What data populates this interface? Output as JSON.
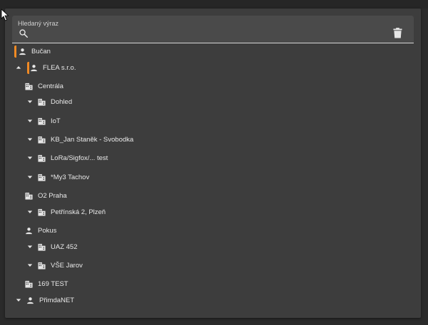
{
  "search": {
    "label": "Hledaný výraz",
    "value": "",
    "placeholder": ""
  },
  "colors": {
    "accent": "#f08a24",
    "panel": "#3d3d3d",
    "background": "#2a2a2a"
  },
  "tree": [
    {
      "id": "n1",
      "label": "Bučan",
      "icon": "person-icon",
      "caret": "none",
      "marked": true
    },
    {
      "id": "n2",
      "label": "FLEA s.r.o.",
      "icon": "person-icon",
      "caret": "up",
      "marked": true
    },
    {
      "id": "n3",
      "label": "Centrála",
      "icon": "building-icon",
      "caret": "none",
      "marked": false
    },
    {
      "id": "n4",
      "label": "Dohled",
      "icon": "building-icon",
      "caret": "down",
      "marked": false
    },
    {
      "id": "n5",
      "label": "IoT",
      "icon": "building-icon",
      "caret": "down",
      "marked": false
    },
    {
      "id": "n6",
      "label": "KB_Jan Staněk - Svobodka",
      "icon": "building-icon",
      "caret": "down",
      "marked": false
    },
    {
      "id": "n7",
      "label": "LoRa/Sigfox/... test",
      "icon": "building-icon",
      "caret": "down",
      "marked": false
    },
    {
      "id": "n8",
      "label": "*My3 Tachov",
      "icon": "building-icon",
      "caret": "down",
      "marked": false
    },
    {
      "id": "n9",
      "label": "O2 Praha",
      "icon": "building-icon",
      "caret": "none",
      "marked": false
    },
    {
      "id": "n10",
      "label": "Petřínská 2, Plzeň",
      "icon": "building-icon",
      "caret": "down",
      "marked": false
    },
    {
      "id": "n11",
      "label": "Pokus",
      "icon": "person-icon",
      "caret": "none",
      "marked": false
    },
    {
      "id": "n12",
      "label": "UAZ 452",
      "icon": "building-icon",
      "caret": "down",
      "marked": false
    },
    {
      "id": "n13",
      "label": "VŠE Jarov",
      "icon": "building-icon",
      "caret": "down",
      "marked": false
    },
    {
      "id": "n14",
      "label": "169 TEST",
      "icon": "building-icon",
      "caret": "none",
      "marked": false
    },
    {
      "id": "n15",
      "label": "PřimdaNET",
      "icon": "person-icon",
      "caret": "down",
      "marked": false
    }
  ]
}
